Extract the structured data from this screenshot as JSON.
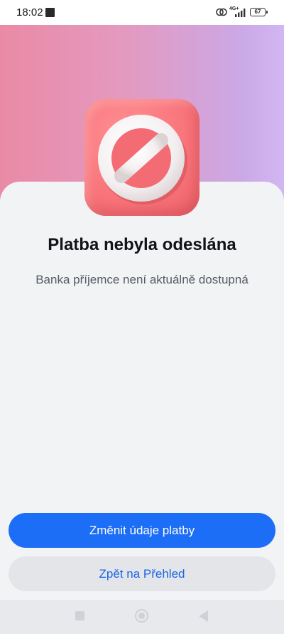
{
  "status_bar": {
    "time": "18:02",
    "network": "4G+",
    "battery": "67",
    "icons": [
      "notification-icon",
      "link-icon",
      "signal-icon",
      "battery-icon"
    ]
  },
  "result": {
    "title": "Platba nebyla odeslána",
    "message": "Banka příjemce není aktuálně dostupná",
    "icon": "no-entry-icon"
  },
  "actions": {
    "primary_label": "Změnit údaje platby",
    "secondary_label": "Zpět na Přehled"
  },
  "nav_bar": {
    "icons": [
      "recent-apps-icon",
      "home-icon",
      "back-icon"
    ]
  },
  "colors": {
    "primary": "#1c6ef7",
    "secondary_text": "#1c66e3",
    "gradient_start": "#ea8aa6",
    "gradient_end": "#d1b7f3",
    "error_red": "#f8757b"
  }
}
